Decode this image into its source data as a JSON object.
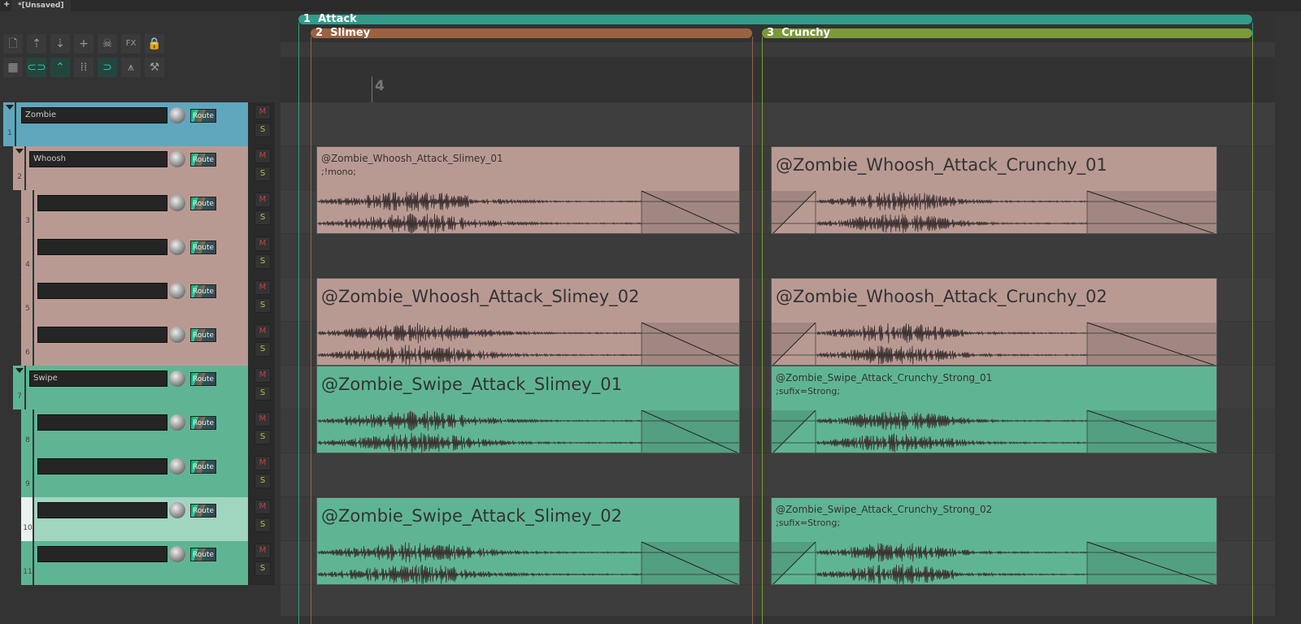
{
  "window": {
    "new_tab": "+",
    "tab_title": "*[Unsaved]"
  },
  "toolbar": {
    "row1": [
      {
        "icon": "new-project-icon",
        "g": "🗋"
      },
      {
        "icon": "render-up-icon",
        "g": "⇡"
      },
      {
        "icon": "render-down-icon",
        "g": "⇣"
      },
      {
        "icon": "insert-track-icon",
        "g": "+"
      },
      {
        "icon": "skull-icon",
        "g": "☠"
      },
      {
        "icon": "fx-icon",
        "g": "FX"
      },
      {
        "icon": "lock-icon",
        "g": "🔒"
      }
    ],
    "row2": [
      {
        "icon": "grid-icon",
        "g": "▦",
        "on": false
      },
      {
        "icon": "link-icon",
        "g": "⊂⊃",
        "on": true
      },
      {
        "icon": "envelope-link-icon",
        "g": "⌃",
        "on": true
      },
      {
        "icon": "grid-lines-icon",
        "g": "⁞⁞",
        "on": false
      },
      {
        "icon": "snap-magnet-icon",
        "g": "⊃",
        "on": true
      },
      {
        "icon": "ripple-icon",
        "g": "⩚",
        "on": false
      },
      {
        "icon": "hammer-icon",
        "g": "⚒",
        "on": false
      }
    ]
  },
  "regions": [
    {
      "num": "1",
      "name": "Attack",
      "color": "#339b8a"
    },
    {
      "num": "2",
      "name": "Slimey",
      "color": "#9b6240"
    },
    {
      "num": "3",
      "name": "Crunchy",
      "color": "#7a9a3a"
    }
  ],
  "ruler": {
    "marker": "4"
  },
  "tracks": [
    {
      "num": "1",
      "name": "Zombie",
      "color": "#5fa7bd",
      "folder": true,
      "route": "Route",
      "mute": "M",
      "solo": "S"
    },
    {
      "num": "2",
      "name": "Whoosh",
      "color": "#b99a93",
      "folder": true,
      "route": "Route",
      "mute": "M",
      "solo": "S"
    },
    {
      "num": "3",
      "name": "",
      "color": "#b99a93",
      "route": "Route",
      "mute": "M",
      "solo": "S"
    },
    {
      "num": "4",
      "name": "",
      "color": "#b99a93",
      "route": "Route",
      "mute": "M",
      "solo": "S"
    },
    {
      "num": "5",
      "name": "",
      "color": "#b99a93",
      "route": "Route",
      "mute": "M",
      "solo": "S"
    },
    {
      "num": "6",
      "name": "",
      "color": "#b99a93",
      "route": "Route",
      "mute": "M",
      "solo": "S"
    },
    {
      "num": "7",
      "name": "Swipe",
      "color": "#5fb593",
      "folder": true,
      "route": "Route",
      "mute": "M",
      "solo": "S"
    },
    {
      "num": "8",
      "name": "",
      "color": "#5fb593",
      "route": "Route",
      "mute": "M",
      "solo": "S"
    },
    {
      "num": "9",
      "name": "",
      "color": "#5fb593",
      "route": "Route",
      "mute": "M",
      "solo": "S"
    },
    {
      "num": "10",
      "name": "",
      "color": "#a0d5c0",
      "selected": true,
      "route": "Route",
      "mute": "M",
      "solo": "S"
    },
    {
      "num": "11",
      "name": "",
      "color": "#5fb593",
      "route": "Route",
      "mute": "M",
      "solo": "S"
    }
  ],
  "items": [
    {
      "title": "@Zombie_Whoosh_Attack_Slimey_01",
      "note": ";!mono;",
      "color": "#b99a93",
      "row": 1,
      "col": 0
    },
    {
      "title": "@Zombie_Whoosh_Attack_Crunchy_01",
      "note": "",
      "color": "#b99a93",
      "row": 1,
      "col": 1
    },
    {
      "title": "@Zombie_Whoosh_Attack_Slimey_02",
      "note": "",
      "color": "#b99a93",
      "row": 4,
      "col": 0
    },
    {
      "title": "@Zombie_Whoosh_Attack_Crunchy_02",
      "note": "",
      "color": "#b99a93",
      "row": 4,
      "col": 1
    },
    {
      "title": "@Zombie_Swipe_Attack_Slimey_01",
      "note": "",
      "color": "#5fb593",
      "row": 6,
      "col": 0
    },
    {
      "title": "@Zombie_Swipe_Attack_Crunchy_Strong_01",
      "note": ";sufix=Strong;",
      "color": "#5fb593",
      "row": 6,
      "col": 1
    },
    {
      "title": "@Zombie_Swipe_Attack_Slimey_02",
      "note": "",
      "color": "#5fb593",
      "row": 9,
      "col": 0
    },
    {
      "title": "@Zombie_Swipe_Attack_Crunchy_Strong_02",
      "note": ";sufix=Strong;",
      "color": "#5fb593",
      "row": 9,
      "col": 1
    }
  ]
}
